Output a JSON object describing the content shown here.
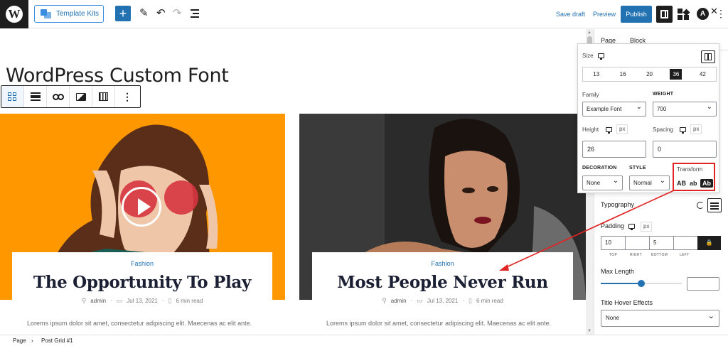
{
  "topbar": {
    "template_kits_label": "Template Kits",
    "add_icon": "plus-icon",
    "tools_icon": "pencil-icon",
    "undo_icon": "undo-icon",
    "redo_icon": "redo-icon",
    "list_view_icon": "list-view-icon",
    "save_draft_label": "Save draft",
    "preview_label": "Preview",
    "publish_label": "Publish",
    "more_icon": "⋮"
  },
  "canvas": {
    "page_title": "WordPress Custom Font",
    "block_toolbar": [
      "grid-icon",
      "align-icon",
      "link-icon",
      "image-icon",
      "table-icon",
      "more-icon"
    ],
    "posts": [
      {
        "category": "Fashion",
        "title": "The Opportunity To Play",
        "author": "admin",
        "date": "Jul 13, 2021",
        "read_time": "6 min read",
        "excerpt": "Lorems ipsum dolor sit amet, consectetur adipiscing elit. Maecenas ac elit ante."
      },
      {
        "category": "Fashion",
        "title": "Most People Never Run",
        "author": "admin",
        "date": "Jul 13, 2021",
        "read_time": "6 min read",
        "excerpt": "Lorems ipsum dolor sit amet, consectetur adipiscing elit. Maecenas ac elit ante."
      }
    ],
    "meta_separator": "·"
  },
  "sidebar": {
    "tabs": [
      "Page",
      "Block"
    ],
    "close_label": "✕",
    "typography_label": "Typography",
    "padding_label": "Padding",
    "padding_unit": "px",
    "padding_values": [
      "10",
      "",
      "5",
      ""
    ],
    "padding_sides": [
      "TOP",
      "RIGHT",
      "BOTTOM",
      "LEFT"
    ],
    "lock_icon": "🔒",
    "max_length_label": "Max Length",
    "max_length_value": "",
    "max_length_level": 0.5,
    "title_hover_label": "Title Hover Effects",
    "title_hover_value": "None"
  },
  "typography_popover": {
    "size_label": "Size",
    "size_options": [
      "13",
      "16",
      "20",
      "36",
      "42"
    ],
    "size_selected": "36",
    "family_label": "Family",
    "family_value": "Example Font",
    "weight_label": "WEIGHT",
    "weight_value": "700",
    "height_label": "Height",
    "height_unit": "px",
    "height_value": "26",
    "spacing_label": "Spacing",
    "spacing_unit": "px",
    "spacing_value": "0",
    "decoration_label": "DECORATION",
    "decoration_value": "None",
    "style_label": "STYLE",
    "style_value": "Normal",
    "transform_label": "Transform",
    "transform_options": [
      "AB",
      "ab",
      "Ab"
    ],
    "transform_selected": "Ab"
  },
  "breadcrumb": {
    "items": [
      "Page",
      "Post Grid #1"
    ],
    "separator": "›"
  },
  "colors": {
    "accent": "#2271b1",
    "highlight": "#e02424",
    "orange": "#ff9800"
  }
}
